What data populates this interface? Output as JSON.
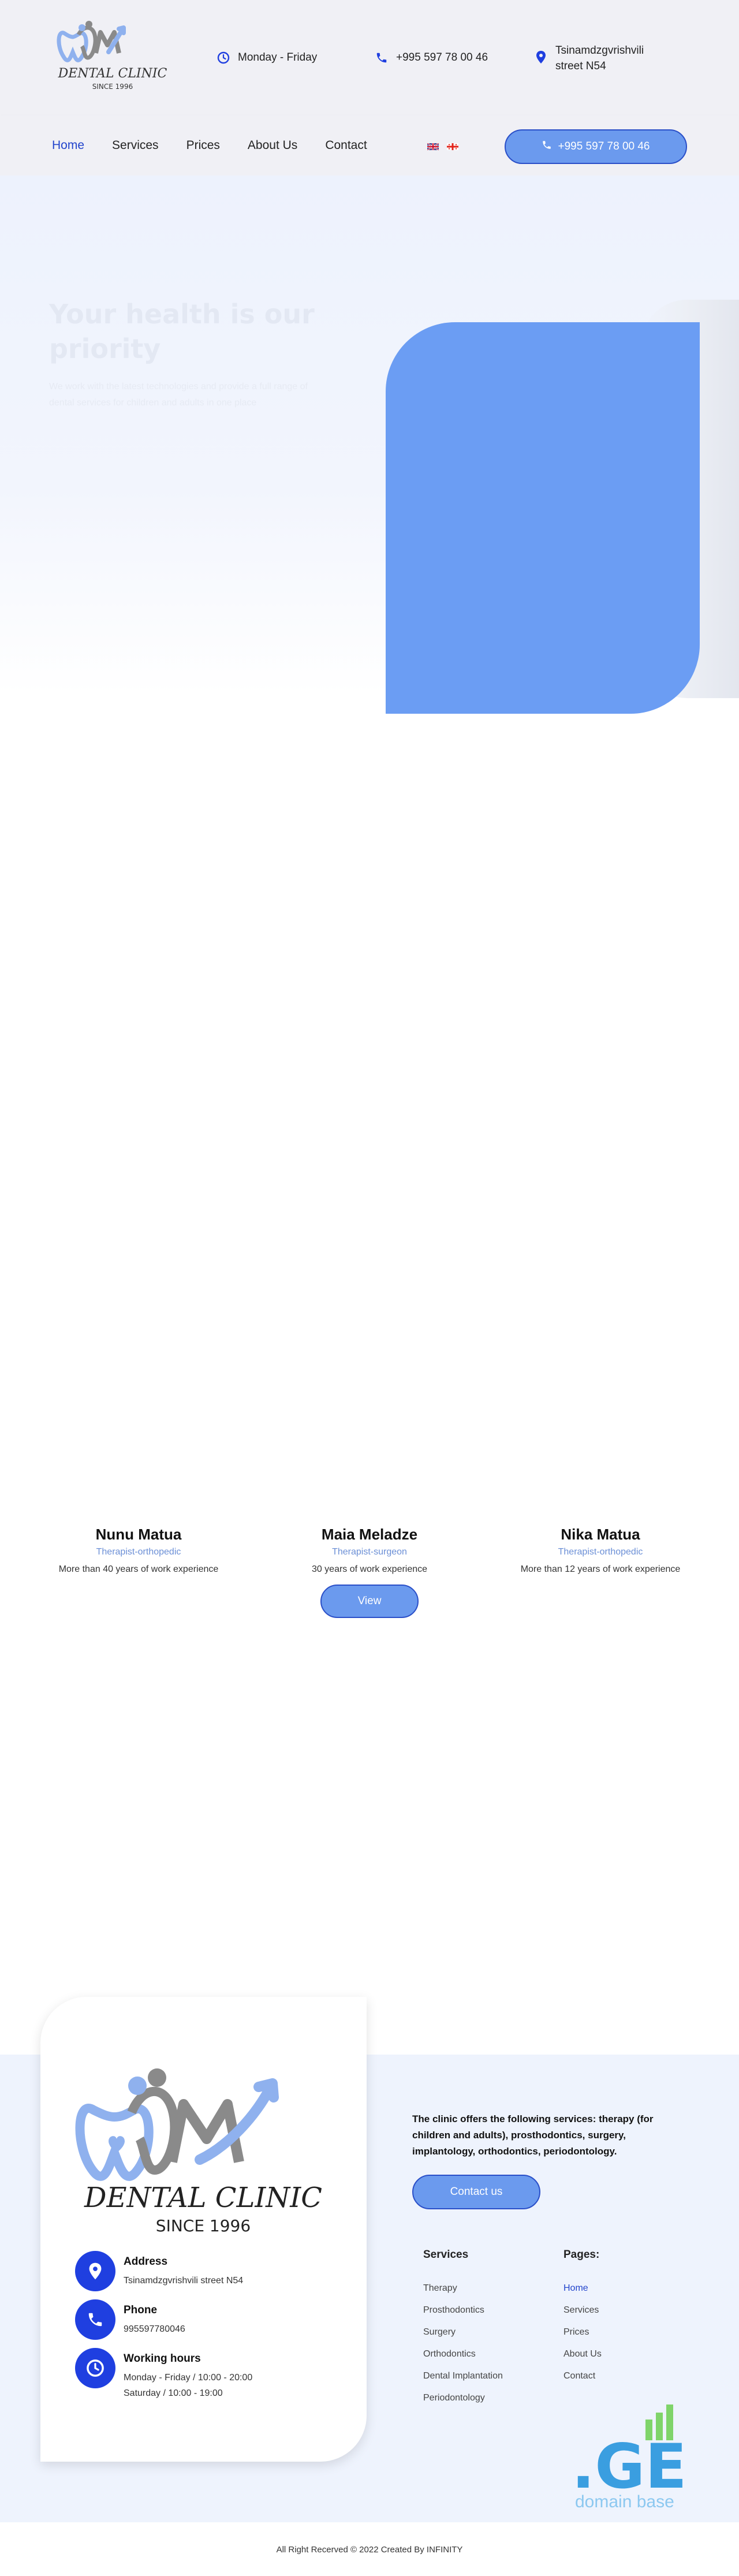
{
  "header": {
    "logo": {
      "brand": "DENTAL CLINIC",
      "since": "SINCE 1996"
    },
    "hours": "Monday - Friday",
    "phone": "+995 597 78 00 46",
    "address_line1": "Tsinamdzgvrishvili",
    "address_line2": "street N54",
    "icons": {
      "hours": "clock-icon",
      "phone": "phone-icon",
      "address": "location-pin-icon"
    }
  },
  "nav": {
    "items": [
      {
        "label": "Home",
        "active": true
      },
      {
        "label": "Services",
        "active": false
      },
      {
        "label": "Prices",
        "active": false
      },
      {
        "label": "About Us",
        "active": false
      },
      {
        "label": "Contact",
        "active": false
      }
    ],
    "call_button": "+995 597 78 00 46"
  },
  "hero": {
    "title": "Your health is our priority",
    "subtitle": "We work with the latest technologies and provide a full range of dental services for children and adults in one place"
  },
  "doctors": [
    {
      "name": "Nunu Matua",
      "role": "Therapist-orthopedic",
      "experience": "More than 40 years of work experience"
    },
    {
      "name": "Maia Meladze",
      "role": "Therapist-surgeon",
      "experience": "30 years of work experience"
    },
    {
      "name": "Nika Matua",
      "role": "Therapist-orthopedic",
      "experience": "More than 12 years of work experience"
    }
  ],
  "doctors_button": "View",
  "footer": {
    "card": {
      "brand": "DENTAL CLINIC",
      "since": "SINCE 1996",
      "address_title": "Address",
      "address_value": "Tsinamdzgvrishvili street N54",
      "phone_title": "Phone",
      "phone_value": "995597780046",
      "hours_title": "Working hours",
      "hours_weekdays": "Monday - Friday / 10:00 - 20:00",
      "hours_saturday": "Saturday / 10:00 - 19:00"
    },
    "services_text": "The clinic offers the following services: therapy (for children and adults), prosthodontics, surgery, implantology, orthodontics, periodontology.",
    "contact_button": "Contact us",
    "services_title": "Services",
    "services": [
      "Therapy",
      "Prosthodontics",
      "Surgery",
      "Orthodontics",
      "Dental Implantation",
      "Periodontology"
    ],
    "pages_title": "Pages:",
    "pages": [
      "Home",
      "Services",
      "Prices",
      "About Us",
      "Contact"
    ],
    "badge_domain": ".GE",
    "badge_text": "domain base"
  },
  "copyright": "All Right Recerved © 2022 Created By INFINITY",
  "colors": {
    "accent": "#6b9aee",
    "accent_border": "#2a4fc8",
    "nav_active": "#2244cc",
    "icon_circle": "#1f3fe0",
    "hero_card": "#6b9df3",
    "role_text": "#6b8fd6"
  }
}
